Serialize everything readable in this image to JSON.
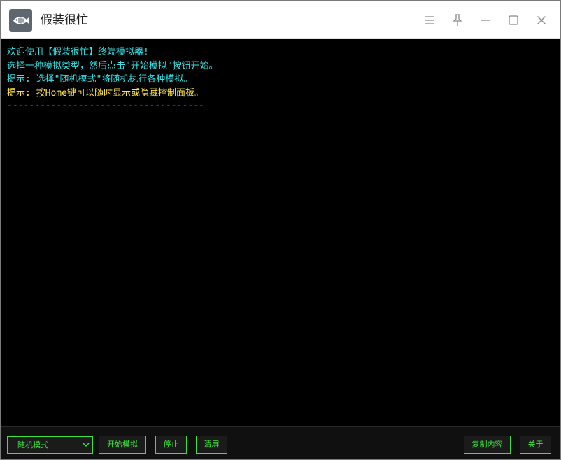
{
  "app": {
    "title": "假装很忙",
    "icon": "fish-icon"
  },
  "titlebar_buttons": [
    "menu-icon",
    "pin-icon",
    "minimize-icon",
    "maximize-icon",
    "close-icon"
  ],
  "terminal": {
    "lines": [
      {
        "text": "欢迎使用【假装很忙】终端模拟器!",
        "color": "#34e3e5"
      },
      {
        "text": "选择一种模拟类型，然后点击\"开始模拟\"按钮开始。",
        "color": "#34e3e5"
      },
      {
        "text": "提示: 选择\"随机模式\"将随机执行各种模拟。",
        "color": "#34e3e5"
      },
      {
        "text": "提示: 按Home键可以随时显示或隐藏控制面板。",
        "color": "#ffe94a"
      }
    ],
    "separator": "------------------------------------"
  },
  "controls": {
    "mode_select_value": "随机模式",
    "start_label": "开始模拟",
    "stop_label": "停止",
    "clear_label": "清屏",
    "copy_label": "复制内容",
    "about_label": "关于"
  },
  "colors": {
    "accent": "#3de23d",
    "cyan_text": "#34e3e5",
    "yellow_text": "#ffe94a"
  }
}
